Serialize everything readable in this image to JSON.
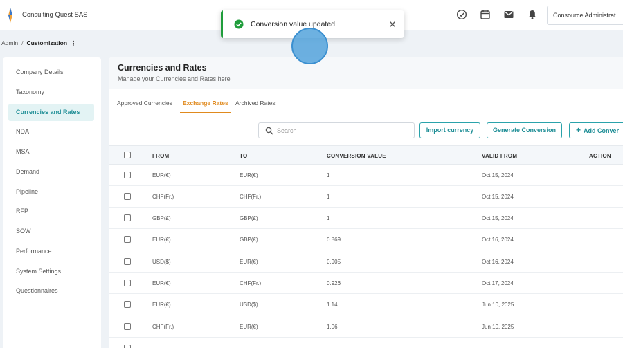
{
  "topbar": {
    "brand": "Consulting Quest SAS",
    "user": "Consource Administrat"
  },
  "breadcrumb": {
    "root": "Admin",
    "separator": "/",
    "current": "Customization",
    "more": "⋮"
  },
  "sidebar": {
    "items": [
      {
        "label": "Company Details"
      },
      {
        "label": "Taxonomy"
      },
      {
        "label": "Currencies and Rates",
        "active": true
      },
      {
        "label": "NDA"
      },
      {
        "label": "MSA"
      },
      {
        "label": "Demand"
      },
      {
        "label": "Pipeline"
      },
      {
        "label": "RFP"
      },
      {
        "label": "SOW"
      },
      {
        "label": "Performance"
      },
      {
        "label": "System Settings"
      },
      {
        "label": "Questionnaires"
      }
    ]
  },
  "page": {
    "title": "Currencies and Rates",
    "subtitle": "Manage your Currencies and Rates here"
  },
  "tabs": [
    {
      "label": "Approved Currencies"
    },
    {
      "label": "Exchange Rates",
      "active": true
    },
    {
      "label": "Archived Rates"
    }
  ],
  "toolbar": {
    "search_placeholder": "Search",
    "import_label": "Import currency",
    "generate_label": "Generate Conversion",
    "add_label": "Add Conver"
  },
  "table": {
    "headers": [
      "FROM",
      "TO",
      "CONVERSION VALUE",
      "VALID FROM",
      "ACTION"
    ],
    "rows": [
      {
        "from": "EUR(€)",
        "to": "EUR(€)",
        "value": "1",
        "valid_from": "Oct 15, 2024"
      },
      {
        "from": "CHF(Fr.)",
        "to": "CHF(Fr.)",
        "value": "1",
        "valid_from": "Oct 15, 2024"
      },
      {
        "from": "GBP(£)",
        "to": "GBP(£)",
        "value": "1",
        "valid_from": "Oct 15, 2024"
      },
      {
        "from": "EUR(€)",
        "to": "GBP(£)",
        "value": "0.869",
        "valid_from": "Oct 16, 2024"
      },
      {
        "from": "USD($)",
        "to": "EUR(€)",
        "value": "0.905",
        "valid_from": "Oct 16, 2024"
      },
      {
        "from": "EUR(€)",
        "to": "CHF(Fr.)",
        "value": "0.926",
        "valid_from": "Oct 17, 2024"
      },
      {
        "from": "EUR(€)",
        "to": "USD($)",
        "value": "1.14",
        "valid_from": "Jun 10, 2025"
      },
      {
        "from": "CHF(Fr.)",
        "to": "EUR(€)",
        "value": "1.06",
        "valid_from": "Jun 10, 2025"
      }
    ]
  },
  "toast": {
    "message": "Conversion value updated",
    "status_color": "#1f9d3b"
  },
  "colors": {
    "accent": "#1f8e96",
    "active_tab": "#e08a1e"
  }
}
